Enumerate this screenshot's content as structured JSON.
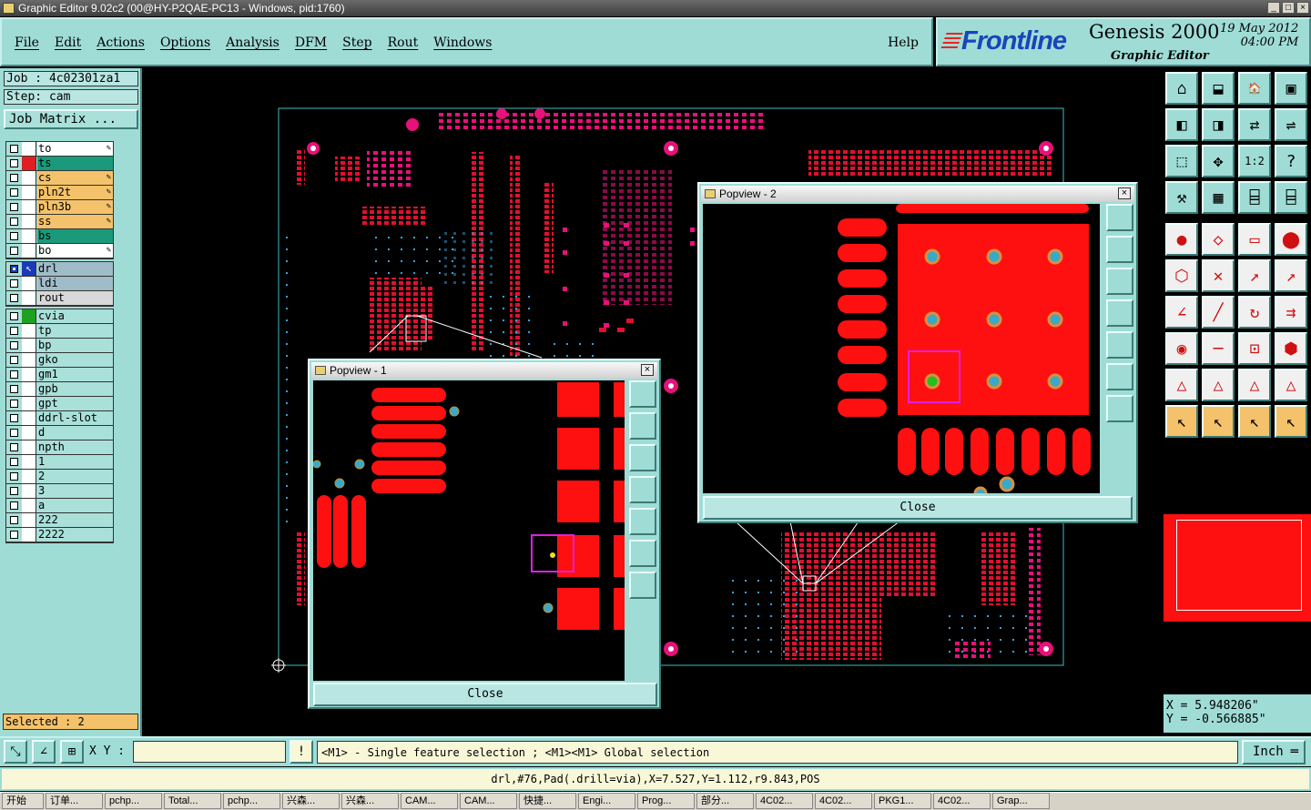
{
  "window": {
    "title": "Graphic Editor 9.02c2 (00@HY-P2QAE-PC13 - Windows, pid:1760)"
  },
  "menu": {
    "items": [
      "File",
      "Edit",
      "Actions",
      "Options",
      "Analysis",
      "DFM",
      "Step",
      "Rout",
      "Windows"
    ],
    "help": "Help"
  },
  "brand": {
    "logo": "Frontline",
    "product": "Genesis 2000",
    "subtitle": "Graphic Editor",
    "date": "19 May 2012",
    "time": "04:00 PM"
  },
  "job": {
    "job": "Job : 4c02301za1",
    "step": "Step: cam",
    "matrix_button": "Job Matrix ..."
  },
  "layers_group1": [
    {
      "name": "to",
      "color": "#ffffff",
      "swatch": "#ffffff",
      "checked": false
    },
    {
      "name": "ts",
      "color": "#1a9a7a",
      "swatch": "#e02020",
      "checked": false
    },
    {
      "name": "cs",
      "color": "#f4c26a",
      "swatch": "#ffffff",
      "checked": false
    },
    {
      "name": "pln2t",
      "color": "#f4c26a",
      "swatch": "#ffffff",
      "checked": false
    },
    {
      "name": "pln3b",
      "color": "#f4c26a",
      "swatch": "#ffffff",
      "checked": false
    },
    {
      "name": "ss",
      "color": "#f4c26a",
      "swatch": "#ffffff",
      "checked": false
    },
    {
      "name": "bs",
      "color": "#1a9a7a",
      "swatch": "#ffffff",
      "checked": false
    },
    {
      "name": "bo",
      "color": "#ffffff",
      "swatch": "#ffffff",
      "checked": false
    }
  ],
  "layers_group2": [
    {
      "name": "drl",
      "color": "#9fbcc8",
      "swatch": "#1a3ab8",
      "checked": true
    },
    {
      "name": "ldi",
      "color": "#9fbcc8",
      "swatch": "#ffffff",
      "checked": false
    },
    {
      "name": "rout",
      "color": "#d8d8d8",
      "swatch": "#ffffff",
      "checked": false
    }
  ],
  "layers_group3": [
    "cvia",
    "tp",
    "bp",
    "gko",
    "gm1",
    "gpb",
    "gpt",
    "ddrl-slot",
    "d",
    "npth",
    "1",
    "2",
    "3",
    "a",
    "222",
    "2222"
  ],
  "selected": "Selected : 2",
  "bottom": {
    "xy_label": "X Y :",
    "xy_value": "",
    "message": "<M1> - Single feature selection ; <M1><M1> Global selection",
    "unit": "Inch"
  },
  "status": "drl,#76,Pad(.drill=via),X=7.527,Y=1.112,r9.843,POS",
  "coords": {
    "x": "X = 5.948206\"",
    "y": "Y = -0.566885\""
  },
  "popview1": {
    "title": "Popview - 1",
    "close": "Close"
  },
  "popview2": {
    "title": "Popview - 2",
    "close": "Close"
  },
  "taskbar": [
    "开始",
    "订单...",
    "pchp...",
    "Total...",
    "pchp...",
    "兴森...",
    "兴森...",
    "CAM...",
    "CAM...",
    "快捷...",
    "Engi...",
    "Prog...",
    "部分...",
    "4C02...",
    "4C02...",
    "PKG1...",
    "4C02...",
    "Grap..."
  ],
  "colors": {
    "panel": "#9fdcd6",
    "copper": "#ff1010",
    "pad": "#e8107a",
    "via": "#3aa8c8"
  }
}
